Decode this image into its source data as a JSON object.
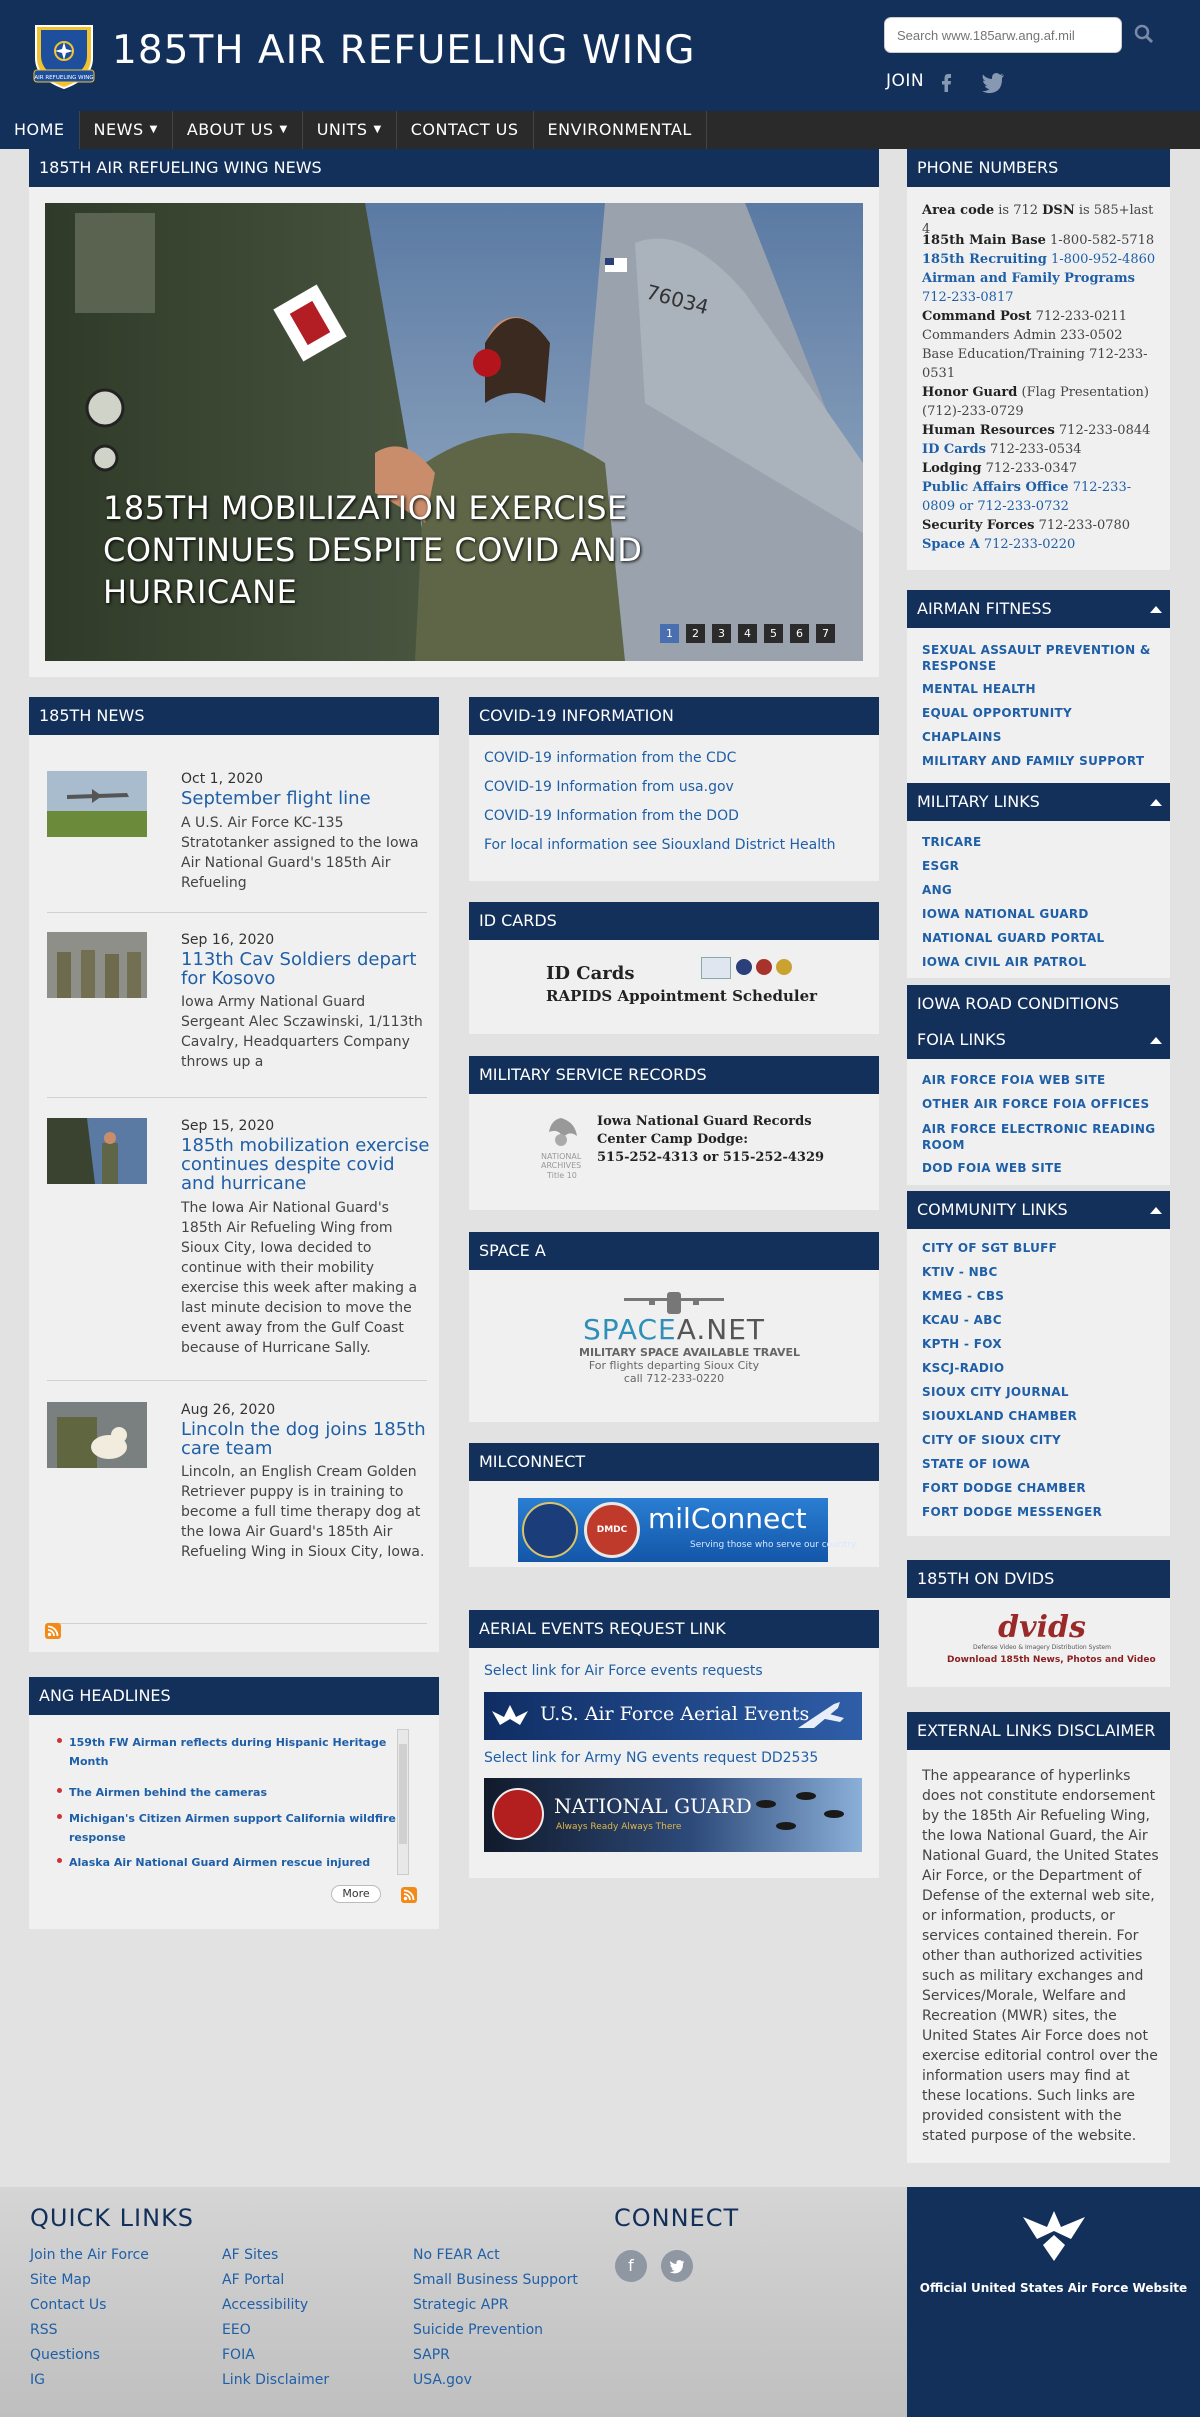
{
  "header": {
    "title": "185TH AIR REFUELING WING",
    "search_placeholder": "Search www.185arw.ang.af.mil",
    "join": "JOIN",
    "seal_text": "AIR REFUELING WING"
  },
  "nav": [
    {
      "label": "HOME"
    },
    {
      "label": "NEWS"
    },
    {
      "label": "ABOUT US"
    },
    {
      "label": "UNITS"
    },
    {
      "label": "CONTACT US"
    },
    {
      "label": "ENVIRONMENTAL"
    }
  ],
  "hero": {
    "section_title": "185TH AIR REFUELING WING NEWS",
    "caption": "185TH MOBILIZATION EXERCISE CONTINUES DESPITE COVID AND HURRICANE",
    "pages": [
      "1",
      "2",
      "3",
      "4",
      "5",
      "6",
      "7"
    ],
    "tail_number": "76034"
  },
  "news": {
    "title": "185TH NEWS",
    "items": [
      {
        "date": "Oct 1, 2020",
        "title": "September flight line",
        "desc": "A U.S. Air Force KC-135 Stratotanker assigned to the Iowa Air National Guard's 185th Air Refueling"
      },
      {
        "date": "Sep 16, 2020",
        "title": "113th Cav Soldiers depart for Kosovo",
        "desc": "Iowa Army National Guard Sergeant Alec Sczawinski, 1/113th Cavalry, Headquarters Company throws up a"
      },
      {
        "date": "Sep 15, 2020",
        "title": "185th mobilization exercise continues despite covid and hurricane",
        "desc": "The Iowa Air National Guard's 185th Air Refueling Wing from Sioux City, Iowa decided to continue with their mobility exercise this week after making a last minute decision to move the event away from the Gulf Coast because of Hurricane Sally."
      },
      {
        "date": "Aug 26, 2020",
        "title": "Lincoln the dog joins 185th care team",
        "desc": "Lincoln, an English Cream Golden Retriever puppy is in training to become a full time therapy dog at the Iowa Air Guard's 185th Air Refueling Wing in Sioux City, Iowa."
      }
    ]
  },
  "ang": {
    "title": "ANG HEADLINES",
    "items": [
      "159th FW Airman reflects during Hispanic Heritage Month",
      "The Airmen behind the cameras",
      "Michigan's Citizen Airmen support California wildfire response",
      "Alaska Air National Guard Airmen rescue injured"
    ],
    "more": "More"
  },
  "covid": {
    "title": "COVID-19 INFORMATION",
    "links": [
      "COVID-19 information from the CDC",
      "COVID-19 Information from usa.gov",
      "COVID-19 Information from the DOD",
      "For local information see Siouxland District Health"
    ]
  },
  "idcards": {
    "title": "ID CARDS",
    "line1": "ID Cards",
    "line2": "RAPIDS Appointment Scheduler"
  },
  "records": {
    "title": "MILITARY SERVICE RECORDS",
    "line1": "Iowa National Guard Records",
    "line2": "Center Camp Dodge:",
    "line3": "515-252-4313 or 515-252-4329",
    "seal1": "NATIONAL",
    "seal2": "ARCHIVES",
    "seal3": "Title 10"
  },
  "spacea": {
    "title": "SPACE A",
    "brand1": "SPACE",
    "brand2": "A.NET",
    "line1": "MILITARY SPACE AVAILABLE TRAVEL",
    "line2": "For flights departing Sioux City",
    "line3": "call 712-233-0220"
  },
  "milconnect": {
    "title": "MILCONNECT",
    "brand": "milConnect",
    "tagline": "Serving those who serve our country.",
    "badge": "DMDC"
  },
  "aerial": {
    "title": "AERIAL EVENTS REQUEST LINK",
    "af_link": "Select link for Air Force events requests",
    "af_banner": "U.S. Air Force Aerial Events",
    "ng_link": "Select link for Army NG events request DD2535",
    "ng_banner": "NATIONAL GUARD",
    "ng_tag": "Always Ready Always There"
  },
  "phones": {
    "title": "PHONE NUMBERS",
    "lines": [
      {
        "k": "Area code",
        "v": " is 712  ",
        "k2": "DSN",
        "v2": " is 585+last 4"
      },
      {
        "k": "185th Main Base",
        "v": " 1-800-582-5718"
      },
      {
        "k": "185th Recruiting",
        "v": " 1-800-952-4860",
        "blue": true
      },
      {
        "k": "Airman and Family Programs",
        "v": " 712-233-0817",
        "blue": true
      },
      {
        "k": "Command Post",
        "v": " 712-233-0211"
      },
      {
        "k": "",
        "v": "Commanders Admin 233-0502"
      },
      {
        "k": "",
        "v": "Base Education/Training 712-233-0531"
      },
      {
        "k": "Honor Guard",
        "v": " (Flag Presentation) (712)-233-0729"
      },
      {
        "k": "Human Resources",
        "v": " 712-233-0844"
      },
      {
        "k": "ID Cards",
        "v": " 712-233-0534",
        "blue": true
      },
      {
        "k": "Lodging",
        "v": " 712-233-0347"
      },
      {
        "k": "Public Affairs Office",
        "v": " 712-233-0809 or 712-233-0732",
        "blue": true
      },
      {
        "k": "Security Forces",
        "v": " 712-233-0780"
      },
      {
        "k": "Space A",
        "v": "  712-233-0220",
        "blue": true
      }
    ]
  },
  "fitness": {
    "title": "AIRMAN FITNESS",
    "links": [
      "SEXUAL ASSAULT PREVENTION & RESPONSE",
      "MENTAL HEALTH",
      "EQUAL OPPORTUNITY",
      "CHAPLAINS",
      "MILITARY AND FAMILY SUPPORT"
    ]
  },
  "military": {
    "title": "MILITARY LINKS",
    "links": [
      "TRICARE",
      "ESGR",
      "ANG",
      "IOWA NATIONAL GUARD",
      "NATIONAL GUARD PORTAL",
      "IOWA CIVIL AIR PATROL"
    ]
  },
  "road": {
    "title": "IOWA ROAD CONDITIONS"
  },
  "foia": {
    "title": "FOIA LINKS",
    "links": [
      "AIR FORCE FOIA WEB SITE",
      "OTHER AIR FORCE FOIA OFFICES",
      "AIR FORCE ELECTRONIC READING ROOM",
      "DOD FOIA WEB SITE"
    ]
  },
  "community": {
    "title": "COMMUNITY LINKS",
    "links": [
      "CITY OF SGT BLUFF",
      "KTIV - NBC",
      "KMEG - CBS",
      "KCAU - ABC",
      "KPTH - FOX",
      "KSCJ-RADIO",
      "SIOUX CITY JOURNAL",
      "SIOUXLAND CHAMBER",
      "CITY OF SIOUX CITY",
      "STATE OF IOWA",
      "FORT DODGE CHAMBER",
      "FORT DODGE MESSENGER"
    ]
  },
  "dvids": {
    "title": "185TH ON DVIDS",
    "brand": "dvids",
    "sub": "Defense Video & Imagery Distribution System",
    "cta": "Download 185th News, Photos and Video"
  },
  "disclaimer": {
    "title": "EXTERNAL LINKS DISCLAIMER",
    "text": "The appearance of hyperlinks does not constitute endorsement by the 185th Air Refueling Wing, the Iowa National Guard, the Air National Guard, the United States Air Force, or the Department of Defense of the external web site, or information, products, or services contained therein. For other than authorized activities such as military exchanges and Services/Morale, Welfare and Recreation (MWR) sites, the United States Air Force does not exercise editorial control over the information users may find at these locations. Such links are provided consistent with the stated purpose of the website."
  },
  "footer": {
    "quick_title": "QUICK LINKS",
    "col1": [
      "Join the Air Force",
      "Site Map",
      "Contact Us",
      "RSS",
      "Questions",
      "IG"
    ],
    "col2": [
      "AF Sites",
      "AF Portal",
      "Accessibility",
      "EEO",
      "FOIA",
      "Link Disclaimer"
    ],
    "col3": [
      "No FEAR Act",
      "Small Business Support",
      "Strategic APR",
      "Suicide Prevention",
      "SAPR",
      "USA.gov"
    ],
    "connect": "CONNECT",
    "af_site": "Official United States Air Force Website"
  },
  "colors": {
    "navy": "#13305a",
    "link": "#1f5fa7",
    "nav_bg": "#2a2a2a",
    "panel": "#f0f0f0"
  }
}
